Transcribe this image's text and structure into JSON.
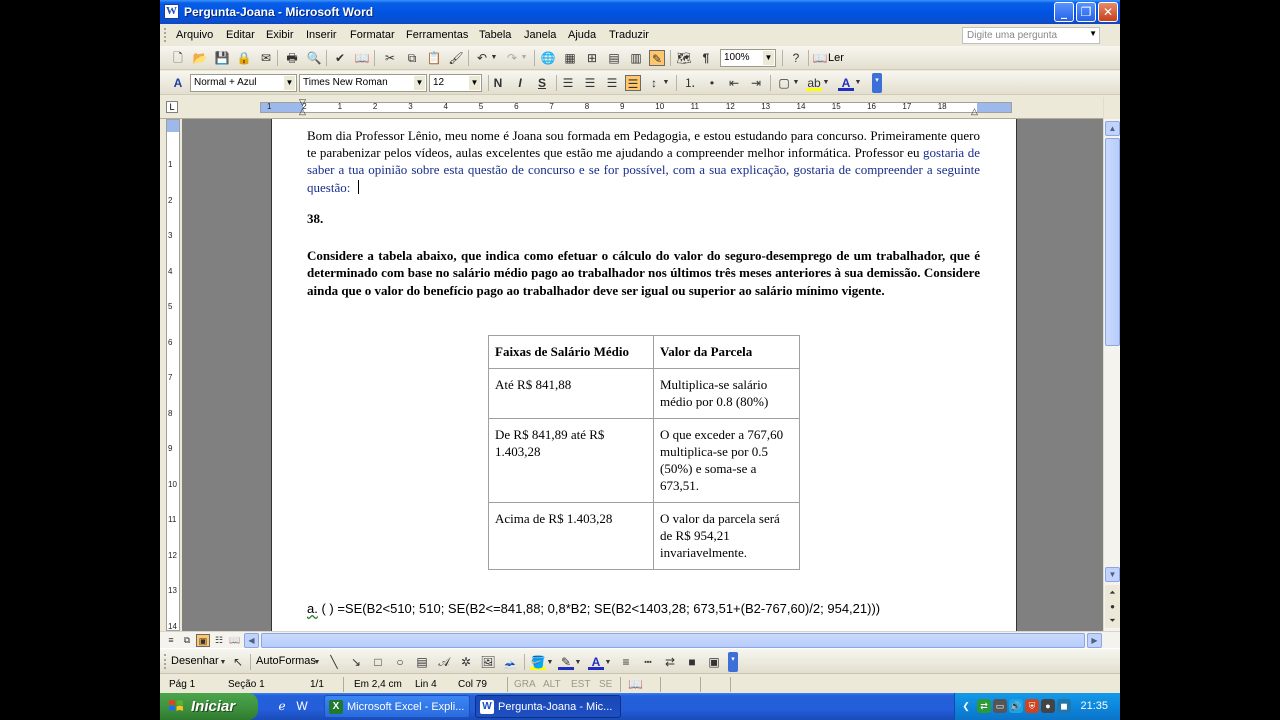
{
  "window": {
    "title": "Pergunta-Joana - Microsoft Word",
    "app_icon": "W"
  },
  "menu": {
    "items": [
      "Arquivo",
      "Editar",
      "Exibir",
      "Inserir",
      "Formatar",
      "Ferramentas",
      "Tabela",
      "Janela",
      "Ajuda",
      "Traduzir"
    ],
    "ask_question_placeholder": "Digite uma pergunta"
  },
  "standard_toolbar": {
    "zoom": "100%",
    "read_label": "Ler"
  },
  "formatting_toolbar": {
    "style": "Normal + Azul",
    "font": "Times New Roman",
    "size": "12",
    "bold": "N",
    "italic": "I",
    "underline": "S"
  },
  "ruler": {
    "numbers": [
      "1",
      "2",
      "1",
      "2",
      "3",
      "4",
      "5",
      "6",
      "7",
      "8",
      "9",
      "10",
      "11",
      "12",
      "13",
      "14",
      "15",
      "16",
      "17",
      "18"
    ],
    "vnumbers": [
      "1",
      "2",
      "3",
      "4",
      "5",
      "6",
      "7",
      "8",
      "9",
      "10",
      "11",
      "12",
      "13",
      "14"
    ]
  },
  "document": {
    "intro_black": "Bom dia Professor Lênio, meu nome é Joana sou formada em Pedagogia, e estou estudando para concurso. Primeiramente quero te parabenizar pelos vídeos, aulas excelentes que estão me ajudando a compreender melhor informática. Professor eu",
    "intro_blue": "gostaria de saber a tua opinião sobre esta questão de concurso e se for possível, com a sua explicação, gostaria de compreender a seguinte questão:",
    "question_number": "38.",
    "question_text": "Considere a tabela abaixo, que indica como efetuar o cálculo do valor do seguro-desemprego de um trabalhador, que é determinado com base no salário médio pago ao trabalhador nos últimos três meses anteriores à sua demissão. Considere ainda que o valor do benefício pago ao trabalhador deve ser igual ou superior ao salário mínimo vigente.",
    "table": {
      "headers": [
        "Faixas de Salário Médio",
        "Valor da Parcela"
      ],
      "rows": [
        [
          "Até R$ 841,88",
          "Multiplica-se salário médio por 0.8 (80%)"
        ],
        [
          "De R$ 841,89 até R$ 1.403,28",
          "O que exceder a 767,60 multiplica-se por 0.5 (50%) e soma-se a 673,51."
        ],
        [
          "Acima de R$ 1.403,28",
          "O valor da parcela será de R$ 954,21 invariavelmente."
        ]
      ]
    },
    "option_letter": "a.",
    "option_text": " ( ) =SE(B2<510; 510; SE(B2<=841,88; 0,8*B2; SE(B2<1403,28; 673,51+(B2-767,60)/2; 954,21)))"
  },
  "drawing_toolbar": {
    "draw_label": "Desenhar",
    "autoshapes_label": "AutoFormas"
  },
  "status": {
    "page": "Pág 1",
    "section": "Seção 1",
    "page_of": "1/1",
    "position": "Em 2,4 cm",
    "line": "Lin 4",
    "column": "Col 79",
    "modes": [
      "GRA",
      "ALT",
      "EST",
      "SE"
    ]
  },
  "taskbar": {
    "start_label": "Iniciar",
    "tasks": [
      "Microsoft Excel - Expli...",
      "Pergunta-Joana - Mic..."
    ],
    "clock": "21:35"
  },
  "colors": {
    "title_bar": "#0054E3",
    "doc_blue_text": "#1a2e8e",
    "taskbar": "#245EDB",
    "start_button": "#3C8F3C",
    "highlight_button": "#FFC66A"
  }
}
